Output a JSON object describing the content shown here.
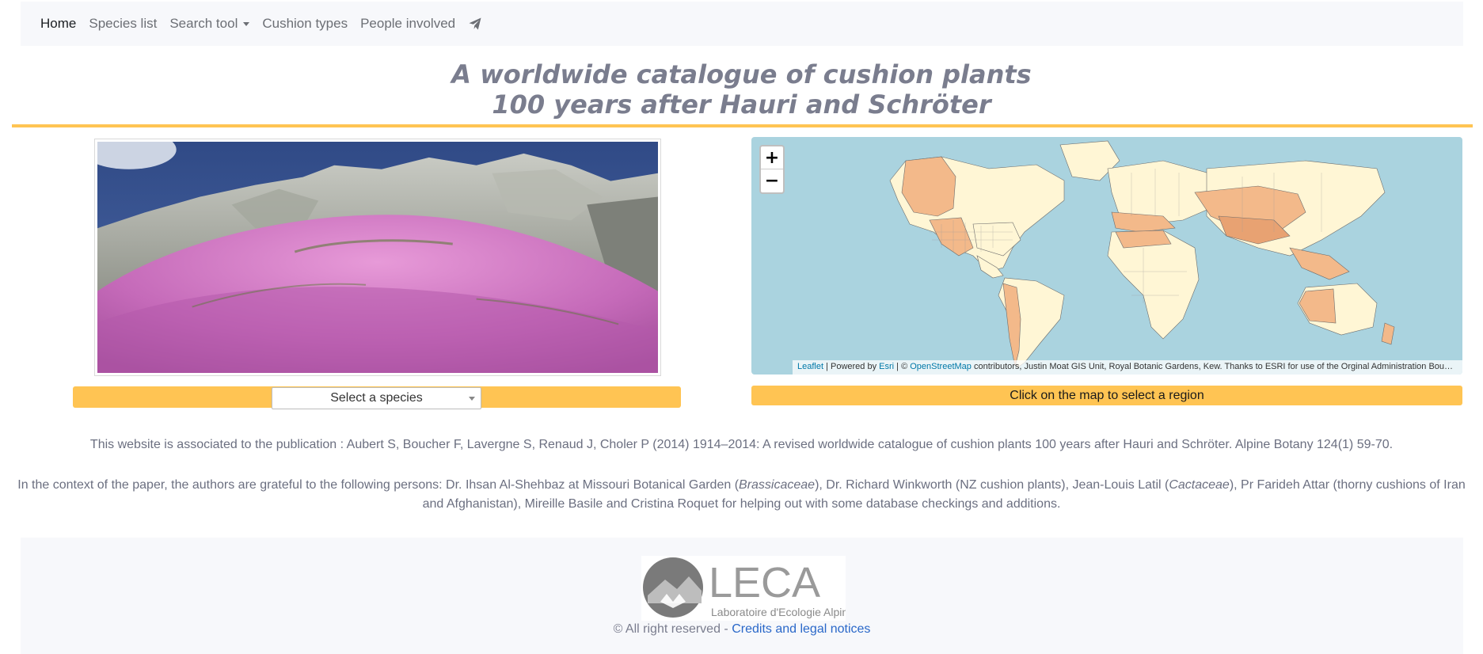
{
  "nav": {
    "items": [
      {
        "label": "Home",
        "active": true
      },
      {
        "label": "Species list"
      },
      {
        "label": "Search tool",
        "dropdown": true
      },
      {
        "label": "Cushion types"
      },
      {
        "label": "People involved"
      }
    ],
    "contact_icon": "paper-plane-icon"
  },
  "header": {
    "title_line1": "A worldwide catalogue of cushion plants",
    "title_line2": "100 years after Hauri and Schröter"
  },
  "species": {
    "select_placeholder": "Select a species"
  },
  "map": {
    "zoom_in": "+",
    "zoom_out": "−",
    "attr_leaflet": "Leaflet",
    "attr_powered": " | Powered by ",
    "attr_esri": "Esri",
    "attr_copy": " | © ",
    "attr_osm": "OpenStreetMap",
    "attr_rest": " contributors, Justin Moat GIS Unit, Royal Botanic Gardens, Kew. Thanks to ESRI for use of the Orginal Administration Boundar...",
    "region_prompt": "Click on the map to select a region"
  },
  "publication": "This website is associated to the publication : Aubert S, Boucher F, Lavergne S, Renaud J, Choler P (2014) 1914–2014: A revised worldwide catalogue of cushion plants 100 years after Hauri and Schröter. Alpine Botany 124(1) 59-70.",
  "thanks": {
    "p1": "In the context of the paper, the authors are grateful to the following persons: Dr. Ihsan Al-Shehbaz at Missouri Botanical Garden (",
    "it1": "Brassicaceae",
    "p2": "), Dr. Richard Winkworth (NZ cushion plants), Jean-Louis Latil (",
    "it2": "Cactaceae",
    "p3": "), Pr Farideh Attar (thorny cushions of Iran and Afghanistan), Mireille Basile and Cristina Roquet for helping out with some database checkings and additions."
  },
  "footer": {
    "logo_text": "LECA",
    "logo_subtitle": "Laboratoire d'Ecologie Alpine",
    "copyright": "© All right reserved - ",
    "credits_link": "Credits and legal notices"
  },
  "colors": {
    "accent": "#ffc453",
    "title": "#7a7d8e",
    "ocean": "#aad3df",
    "land": "#fff6d5",
    "region_highlight": "#f3b98a",
    "link": "#2a68c9"
  }
}
